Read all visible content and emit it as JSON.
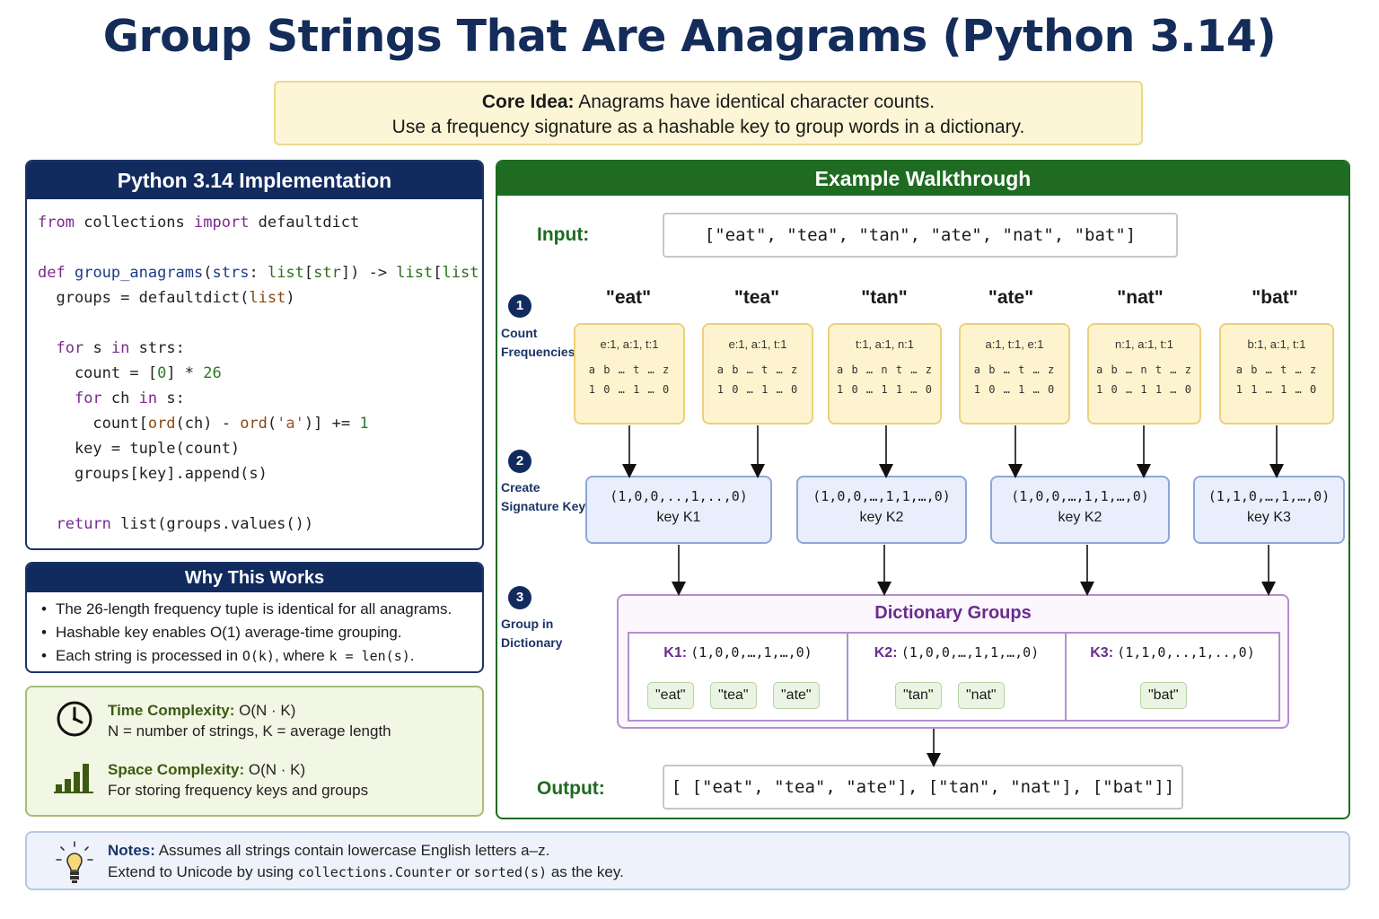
{
  "title": "Group Strings That Are Anagrams (Python 3.14)",
  "core": {
    "label": "Core Idea:",
    "line1": "Anagrams have identical character counts.",
    "line2": "Use a frequency signature as a hashable key to group words in a dictionary."
  },
  "impl": {
    "heading": "Python 3.14 Implementation"
  },
  "why": {
    "heading": "Why This Works",
    "b1": "The 26-length frequency tuple is identical for all anagrams.",
    "b2": "Hashable key enables O(1) average-time grouping.",
    "b3a": "Each string is processed in ",
    "b3b": "O(k)",
    "b3c": ", where ",
    "b3d": "k = len(s)",
    "b3e": "."
  },
  "complexity": {
    "time_label": "Time Complexity:",
    "time_value": "O(N · K)",
    "time_desc": "N = number of strings, K = average length",
    "space_label": "Space Complexity:",
    "space_value": "O(N · K)",
    "space_desc": "For storing frequency keys and groups"
  },
  "notes": {
    "label": "Notes:",
    "line1": "Assumes all strings contain lowercase English letters a–z.",
    "line2a": "Extend to Unicode by using ",
    "line2b": "collections.Counter",
    "line2c": " or ",
    "line2d": "sorted(s)",
    "line2e": " as the key."
  },
  "walk": {
    "heading": "Example Walkthrough",
    "input_label": "Input:",
    "input_value": "[\"eat\", \"tea\", \"tan\", \"ate\", \"nat\", \"bat\"]",
    "output_label": "Output:",
    "output_value": "[ [\"eat\", \"tea\", \"ate\"], [\"tan\", \"nat\"], [\"bat\"]]",
    "steps": [
      {
        "num": "1",
        "l1": "Count",
        "l2": "Frequencies"
      },
      {
        "num": "2",
        "l1": "Create",
        "l2": "Signature Key"
      },
      {
        "num": "3",
        "l1": "Group in",
        "l2": "Dictionary"
      }
    ],
    "words": [
      "\"eat\"",
      "\"tea\"",
      "\"tan\"",
      "\"ate\"",
      "\"nat\"",
      "\"bat\""
    ],
    "freqs": [
      {
        "counts": "e:1, a:1, t:1",
        "letters": "a b … t … z",
        "values": "1 0 … 1 … 0"
      },
      {
        "counts": "e:1, a:1, t:1",
        "letters": "a b … t … z",
        "values": "1 0 … 1 … 0"
      },
      {
        "counts": "t:1, a:1, n:1",
        "letters": "a b … n t … z",
        "values": "1 0 … 1 1 … 0"
      },
      {
        "counts": "a:1, t:1, e:1",
        "letters": "a b … t … z",
        "values": "1 0 … 1 … 0"
      },
      {
        "counts": "n:1, a:1, t:1",
        "letters": "a b … n t … z",
        "values": "1 0 … 1 1 … 0"
      },
      {
        "counts": "b:1, a:1, t:1",
        "letters": "a b … t … z",
        "values": "1 1 … 1 … 0"
      }
    ],
    "sigs": [
      {
        "tuple": "(1,0,0,..,1,..,0)",
        "key": "key K1"
      },
      {
        "tuple": "(1,0,0,…,1,1,…,0)",
        "key": "key K2"
      },
      {
        "tuple": "(1,0,0,…,1,1,…,0)",
        "key": "key K2"
      },
      {
        "tuple": "(1,1,0,…,1,…,0)",
        "key": "key K3"
      }
    ],
    "dict": {
      "title": "Dictionary Groups",
      "groups": [
        {
          "key": "K1:",
          "tuple": "(1,0,0,…,1,…,0)",
          "items": [
            "\"eat\"",
            "\"tea\"",
            "\"ate\""
          ]
        },
        {
          "key": "K2:",
          "tuple": "(1,0,0,…,1,1,…,0)",
          "items": [
            "\"tan\"",
            "\"nat\""
          ]
        },
        {
          "key": "K3:",
          "tuple": "(1,1,0,..,1,..,0)",
          "items": [
            "\"bat\""
          ]
        }
      ]
    }
  },
  "colors": {
    "navy": "#122b5e",
    "green": "#1e6b21",
    "purple": "#6a2c8e",
    "yellow_fill": "#fdf4cf",
    "blue_fill": "#e8eefb"
  },
  "icons": [
    "clock-icon",
    "bar-chart-icon",
    "lightbulb-icon"
  ]
}
